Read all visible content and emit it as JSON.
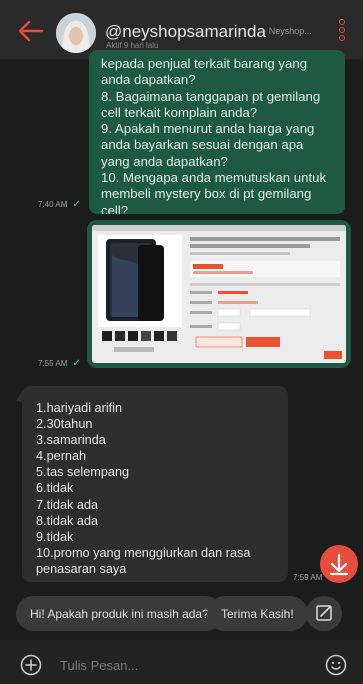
{
  "header": {
    "title": "@neyshopsamarinda",
    "shop_suffix": "~ Neyshop...",
    "status": "Aktif 9 hari lalu",
    "back_icon": "arrow-left-icon",
    "menu_icon": "more-vertical-icon"
  },
  "messages": {
    "outgoing_text": {
      "lines": [
        "kepada penjual terkait barang yang anda dapatkan?",
        "8.  Bagaimana tanggapan pt gemilang cell terkait komplain anda?",
        "9.  Apakah menurut anda harga yang anda bayarkan sesuai dengan apa yang anda dapatkan?",
        "10. Mengapa anda memutuskan untuk membeli mystery box di pt gemilang cell?"
      ],
      "time": "7:40 AM"
    },
    "outgoing_image": {
      "time": "7:55 AM"
    },
    "incoming_text": {
      "lines": [
        "1.hariyadi arifin",
        "2.30tahun",
        "3.samarinda",
        "4.pernah",
        "5.tas selempang",
        "6.tidak",
        "7.tidak ada",
        "8.tidak ada",
        "9.tidak",
        "10.promo yang menggiurkan dan rasa penasaran saya"
      ],
      "time": "7:59 AM"
    }
  },
  "quick_replies": [
    "Hi! Apakah produk ini masih ada?",
    "Terima Kasih!"
  ],
  "composer": {
    "placeholder": "Tulis Pesan...",
    "add_icon": "plus-circle-icon",
    "emoji_icon": "smiley-icon"
  },
  "colors": {
    "accent": "#e84c3d",
    "outgoing_bubble": "#1e5a43",
    "incoming_bubble": "#2e2e2e",
    "background": "#1c1c1c"
  }
}
